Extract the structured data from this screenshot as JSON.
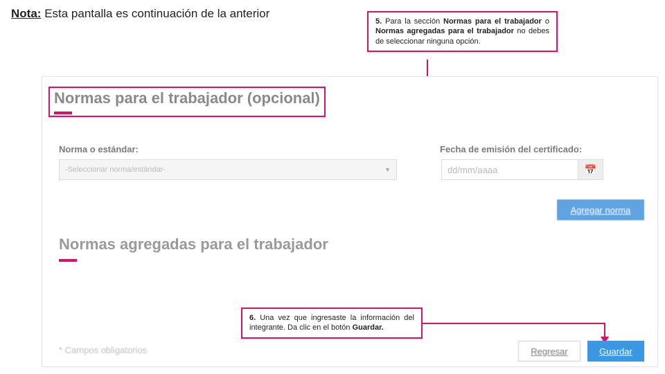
{
  "note": {
    "label": "Nota:",
    "text": "Esta pantalla es continuación de la anterior"
  },
  "callout5": {
    "num": "5.",
    "p1a": "Para la sección ",
    "p1b": "Normas para el trabajador",
    "p2a": " o ",
    "p2b": "Normas agregadas para el trabajador",
    "p3": " no debes de seleccionar ninguna opción."
  },
  "callout6": {
    "num": "6.",
    "text_a": "Una vez que ingresaste la información del integrante. Da clic en el botón ",
    "text_b": "Guardar."
  },
  "section1": {
    "title": "Normas para el trabajador (opcional)",
    "label_norma": "Norma o estándar:",
    "label_fecha": "Fecha de emisión del certificado:",
    "select_placeholder": "-Seleccionar norma/estándar-",
    "date_placeholder": "dd/mm/aaaa",
    "btn_agregar": "Agregar norma"
  },
  "section2": {
    "title": "Normas agregadas para el trabajador"
  },
  "footer": {
    "required": "* Campos obligatorios",
    "btn_regresar": "Regresar",
    "btn_guardar": "Guardar"
  }
}
